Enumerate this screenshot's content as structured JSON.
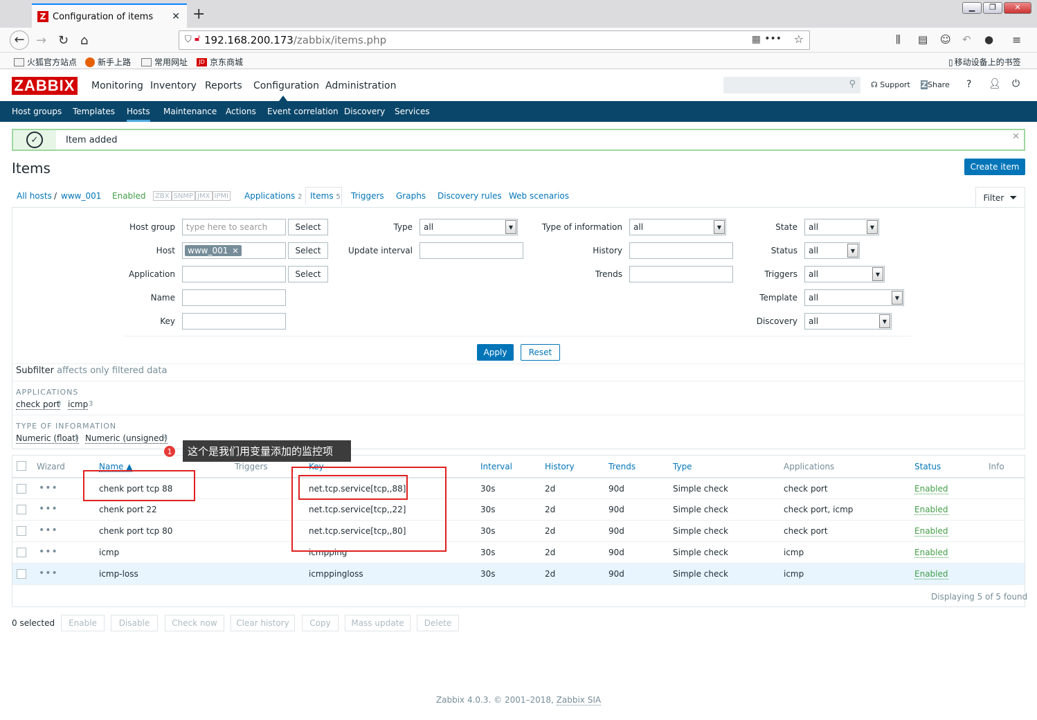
{
  "browser": {
    "tab_title": "Configuration of items",
    "url_host": "192.168.200.173",
    "url_path": "/zabbix/items.php",
    "bookmarks": [
      "火狐官方站点",
      "新手上路",
      "常用网址",
      "京东商城"
    ],
    "mobile_bookmarks": "移动设备上的书签",
    "win_min": "▁",
    "win_max": "❐",
    "win_close": "✕"
  },
  "header": {
    "logo": "ZABBIX",
    "menu": [
      "Monitoring",
      "Inventory",
      "Reports",
      "Configuration",
      "Administration"
    ],
    "support": "Support",
    "share": "Share",
    "help": "?"
  },
  "subnav": [
    "Host groups",
    "Templates",
    "Hosts",
    "Maintenance",
    "Actions",
    "Event correlation",
    "Discovery",
    "Services"
  ],
  "message": {
    "text": "Item added"
  },
  "page": {
    "title": "Items",
    "create_button": "Create item"
  },
  "breadcrumbs": {
    "all_hosts": "All hosts",
    "sep": "/",
    "host": "www_001",
    "status": "Enabled",
    "availability": [
      "ZBX",
      "SNMP",
      "JMX",
      "IPMI"
    ],
    "tabs": [
      {
        "label": "Applications",
        "count": "2"
      },
      {
        "label": "Items",
        "count": "5"
      },
      {
        "label": "Triggers",
        "count": ""
      },
      {
        "label": "Graphs",
        "count": ""
      },
      {
        "label": "Discovery rules",
        "count": ""
      },
      {
        "label": "Web scenarios",
        "count": ""
      }
    ],
    "filter_tab": "Filter"
  },
  "filter": {
    "host_group_label": "Host group",
    "host_group_placeholder": "type here to search",
    "host_label": "Host",
    "host_chip": "www_001",
    "application_label": "Application",
    "name_label": "Name",
    "key_label": "Key",
    "select": "Select",
    "type_label": "Type",
    "type_value": "all",
    "update_interval_label": "Update interval",
    "type_info_label": "Type of information",
    "type_info_value": "all",
    "history_label": "History",
    "trends_label": "Trends",
    "state_label": "State",
    "state_value": "all",
    "status_label": "Status",
    "status_value": "all",
    "triggers_label": "Triggers",
    "triggers_value": "all",
    "template_label": "Template",
    "template_value": "all",
    "discovery_label": "Discovery",
    "discovery_value": "all",
    "apply": "Apply",
    "reset": "Reset"
  },
  "subfilter": {
    "title": "Subfilter",
    "note": "affects only filtered data",
    "applications_header": "APPLICATIONS",
    "applications": [
      {
        "label": "check port",
        "count": "3"
      },
      {
        "label": "icmp",
        "count": "3"
      }
    ],
    "type_header": "TYPE OF INFORMATION",
    "types": [
      {
        "label": "Numeric (float)",
        "count": "1"
      },
      {
        "label": "Numeric (unsigned)",
        "count": "4"
      }
    ]
  },
  "annotation": {
    "number": "1",
    "text": "这个是我们用变量添加的监控项"
  },
  "table": {
    "headers": [
      "Wizard",
      "Name ▲",
      "Triggers",
      "Key",
      "Interval",
      "History",
      "Trends",
      "Type",
      "Applications",
      "Status",
      "Info"
    ],
    "rows": [
      {
        "name": "chenk port tcp 88",
        "key": "net.tcp.service[tcp,,88]",
        "interval": "30s",
        "history": "2d",
        "trends": "90d",
        "type": "Simple check",
        "applications": "check port",
        "status": "Enabled"
      },
      {
        "name": "chenk port 22",
        "key": "net.tcp.service[tcp,,22]",
        "interval": "30s",
        "history": "2d",
        "trends": "90d",
        "type": "Simple check",
        "applications": "check port, icmp",
        "status": "Enabled"
      },
      {
        "name": "chenk port tcp 80",
        "key": "net.tcp.service[tcp,,80]",
        "interval": "30s",
        "history": "2d",
        "trends": "90d",
        "type": "Simple check",
        "applications": "check port",
        "status": "Enabled"
      },
      {
        "name": "icmp",
        "key": "icmpping",
        "interval": "30s",
        "history": "2d",
        "trends": "90d",
        "type": "Simple check",
        "applications": "icmp",
        "status": "Enabled"
      },
      {
        "name": "icmp-loss",
        "key": "icmppingloss",
        "interval": "30s",
        "history": "2d",
        "trends": "90d",
        "type": "Simple check",
        "applications": "icmp",
        "status": "Enabled"
      }
    ],
    "displaying": "Displaying 5 of 5 found"
  },
  "actions": {
    "selected": "0 selected",
    "buttons": [
      "Enable",
      "Disable",
      "Check now",
      "Clear history",
      "Copy",
      "Mass update",
      "Delete"
    ]
  },
  "footer": {
    "text": "Zabbix 4.0.3. © 2001–2018, ",
    "link": "Zabbix SIA"
  }
}
